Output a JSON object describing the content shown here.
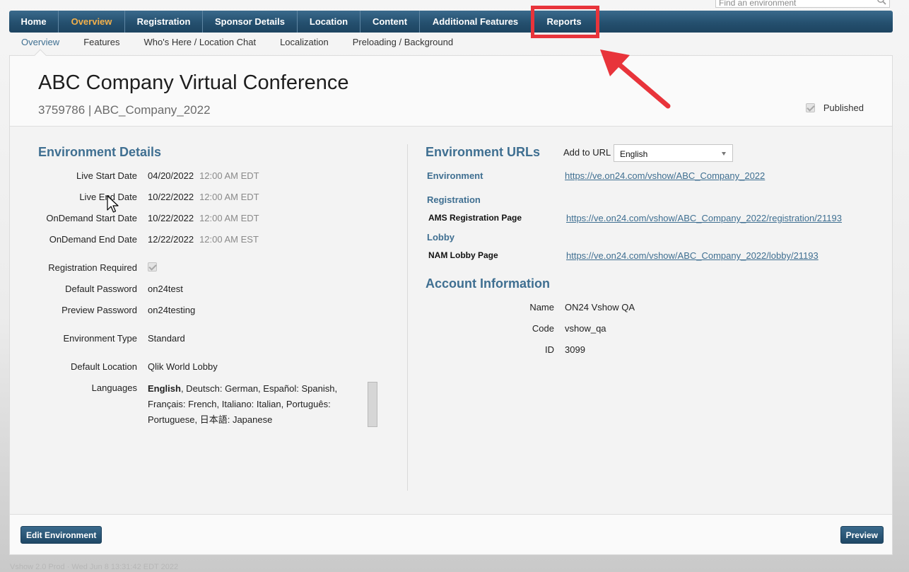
{
  "search": {
    "placeholder": "Find an environment"
  },
  "nav": {
    "items": [
      {
        "label": "Home"
      },
      {
        "label": "Overview",
        "active": true
      },
      {
        "label": "Registration"
      },
      {
        "label": "Sponsor Details"
      },
      {
        "label": "Location"
      },
      {
        "label": "Content"
      },
      {
        "label": "Additional Features"
      },
      {
        "label": "Reports"
      }
    ]
  },
  "subnav": {
    "items": [
      {
        "label": "Overview",
        "active": true
      },
      {
        "label": "Features"
      },
      {
        "label": "Who's Here / Location Chat"
      },
      {
        "label": "Localization"
      },
      {
        "label": "Preloading / Background"
      }
    ]
  },
  "header": {
    "title": "ABC Company Virtual Conference",
    "subtitle": "3759786 | ABC_Company_2022",
    "published_label": "Published"
  },
  "details": {
    "title": "Environment Details",
    "dates": [
      {
        "label": "Live Start Date",
        "date": "04/20/2022",
        "time": "12:00 AM EDT"
      },
      {
        "label": "Live End Date",
        "date": "10/22/2022",
        "time": "12:00 AM EDT"
      },
      {
        "label": "OnDemand Start Date",
        "date": "10/22/2022",
        "time": "12:00 AM EDT"
      },
      {
        "label": "OnDemand End Date",
        "date": "12/22/2022",
        "time": "12:00 AM EST"
      }
    ],
    "registration_required_label": "Registration Required",
    "default_password_label": "Default Password",
    "default_password": "on24test",
    "preview_password_label": "Preview Password",
    "preview_password": "on24testing",
    "environment_type_label": "Environment Type",
    "environment_type": "Standard",
    "default_location_label": "Default Location",
    "default_location": "Qlik World Lobby",
    "languages_label": "Languages",
    "languages_primary": "English",
    "languages_rest": ", Deutsch: German, Español: Spanish, Français: French, Italiano: Italian, Português: Portuguese, 日本語: Japanese"
  },
  "urls": {
    "title": "Environment URLs",
    "add_to_url_label": "Add to URL",
    "add_to_url_value": "English",
    "environment_heading": "Environment",
    "environment_url": "https://ve.on24.com/vshow/ABC_Company_2022",
    "registration_heading": "Registration",
    "registration_key": "AMS Registration Page",
    "registration_url": "https://ve.on24.com/vshow/ABC_Company_2022/registration/21193",
    "lobby_heading": "Lobby",
    "lobby_key": "NAM Lobby Page",
    "lobby_url": "https://ve.on24.com/vshow/ABC_Company_2022/lobby/21193"
  },
  "account": {
    "title": "Account Information",
    "name_label": "Name",
    "name": "ON24 Vshow QA",
    "code_label": "Code",
    "code": "vshow_qa",
    "id_label": "ID",
    "id": "3099"
  },
  "footer": {
    "edit_label": "Edit Environment",
    "preview_label": "Preview",
    "faint_text": "Vshow 2.0 Prod · Wed Jun 8 13:31:42 EDT 2022"
  },
  "colors": {
    "nav_blue": "#25506f",
    "active_orange": "#f3b04a",
    "heading_blue": "#3f6f91",
    "annotation_red": "#e8343b"
  }
}
